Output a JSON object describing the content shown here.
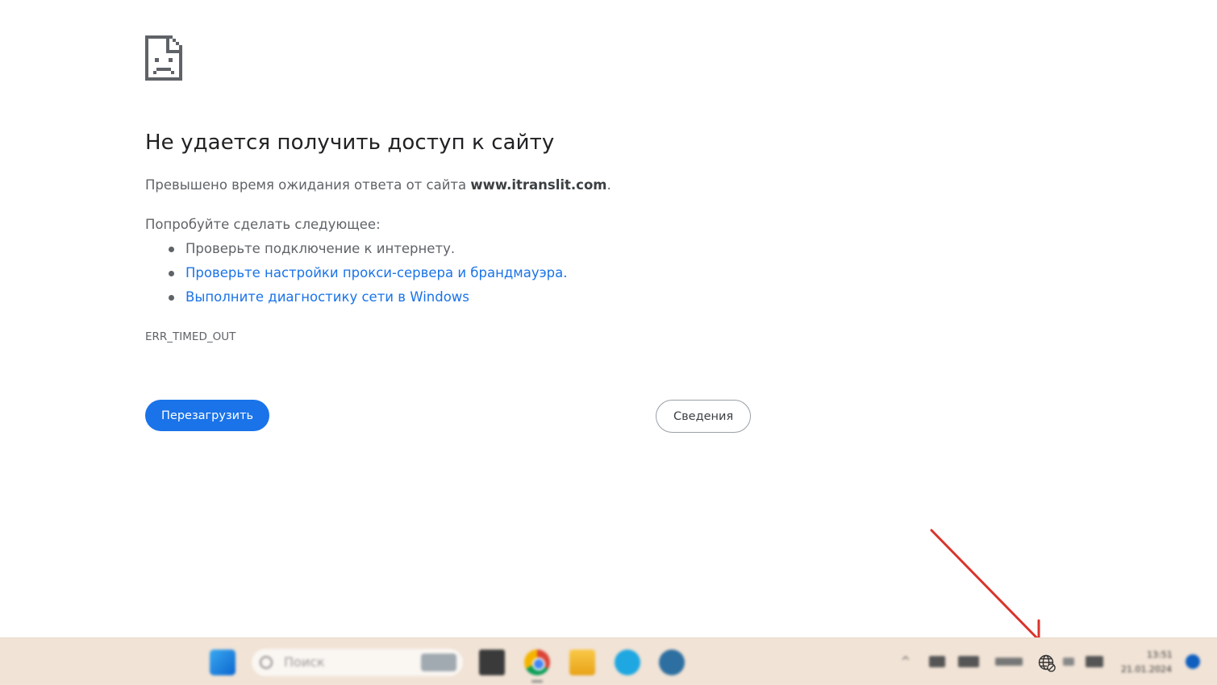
{
  "error_page": {
    "heading": "Не удается получить доступ к сайту",
    "summary_prefix": "Превышено время ожидания ответа от сайта ",
    "summary_host": "www.itranslit.com",
    "summary_suffix": ".",
    "suggestions_heading": "Попробуйте сделать следующее:",
    "suggestions": [
      {
        "text": "Проверьте подключение к интернету."
      },
      {
        "text": "Проверьте настройки прокси-сервера и брандмауэра."
      },
      {
        "text": "Выполните диагностику сети в Windows"
      }
    ],
    "error_code": "ERR_TIMED_OUT",
    "reload_label": "Перезагрузить",
    "details_label": "Сведения"
  },
  "taskbar": {
    "search_placeholder": "Поиск",
    "clock_time": "13:51",
    "clock_date": "21.01.2024"
  },
  "colors": {
    "link": "#1a73e8",
    "primary_button": "#1a73e8",
    "annotation_arrow": "#d9342b",
    "taskbar_bg": "#f1e3d6"
  },
  "icons": {
    "page_icon": "sad-document-icon",
    "network_status": "globe-disconnected-icon"
  }
}
